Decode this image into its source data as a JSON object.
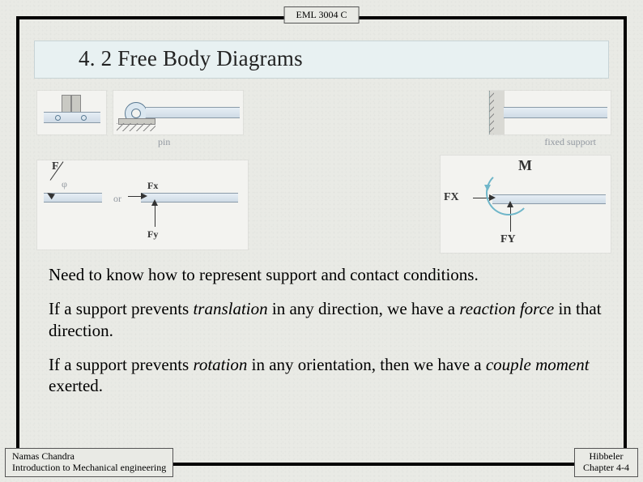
{
  "course_code": "EML 3004 C",
  "title": "4. 2   Free Body Diagrams",
  "paragraphs": {
    "p1": "Need to know how to represent support and contact conditions.",
    "p2_a": "If a support prevents ",
    "p2_b": "translation",
    "p2_c": " in any direction, we have a ",
    "p2_d": "reaction force",
    "p2_e": " in that direction.",
    "p3_a": "If a support prevents ",
    "p3_b": "rotation",
    "p3_c": " in any orientation, then we have a ",
    "p3_d": "couple moment",
    "p3_e": " exerted."
  },
  "diagram": {
    "pin_label": "pin",
    "fixed_label": "fixed support",
    "F": "F",
    "phi": "φ",
    "or": "or",
    "Fx": "Fx",
    "Fy": "Fy",
    "FX": "FX",
    "FY": "FY",
    "M": "M"
  },
  "footer": {
    "left_line1": "Namas Chandra",
    "left_line2": "Introduction to Mechanical engineering",
    "right_line1": "Hibbeler",
    "right_line2": "Chapter 4-4"
  }
}
